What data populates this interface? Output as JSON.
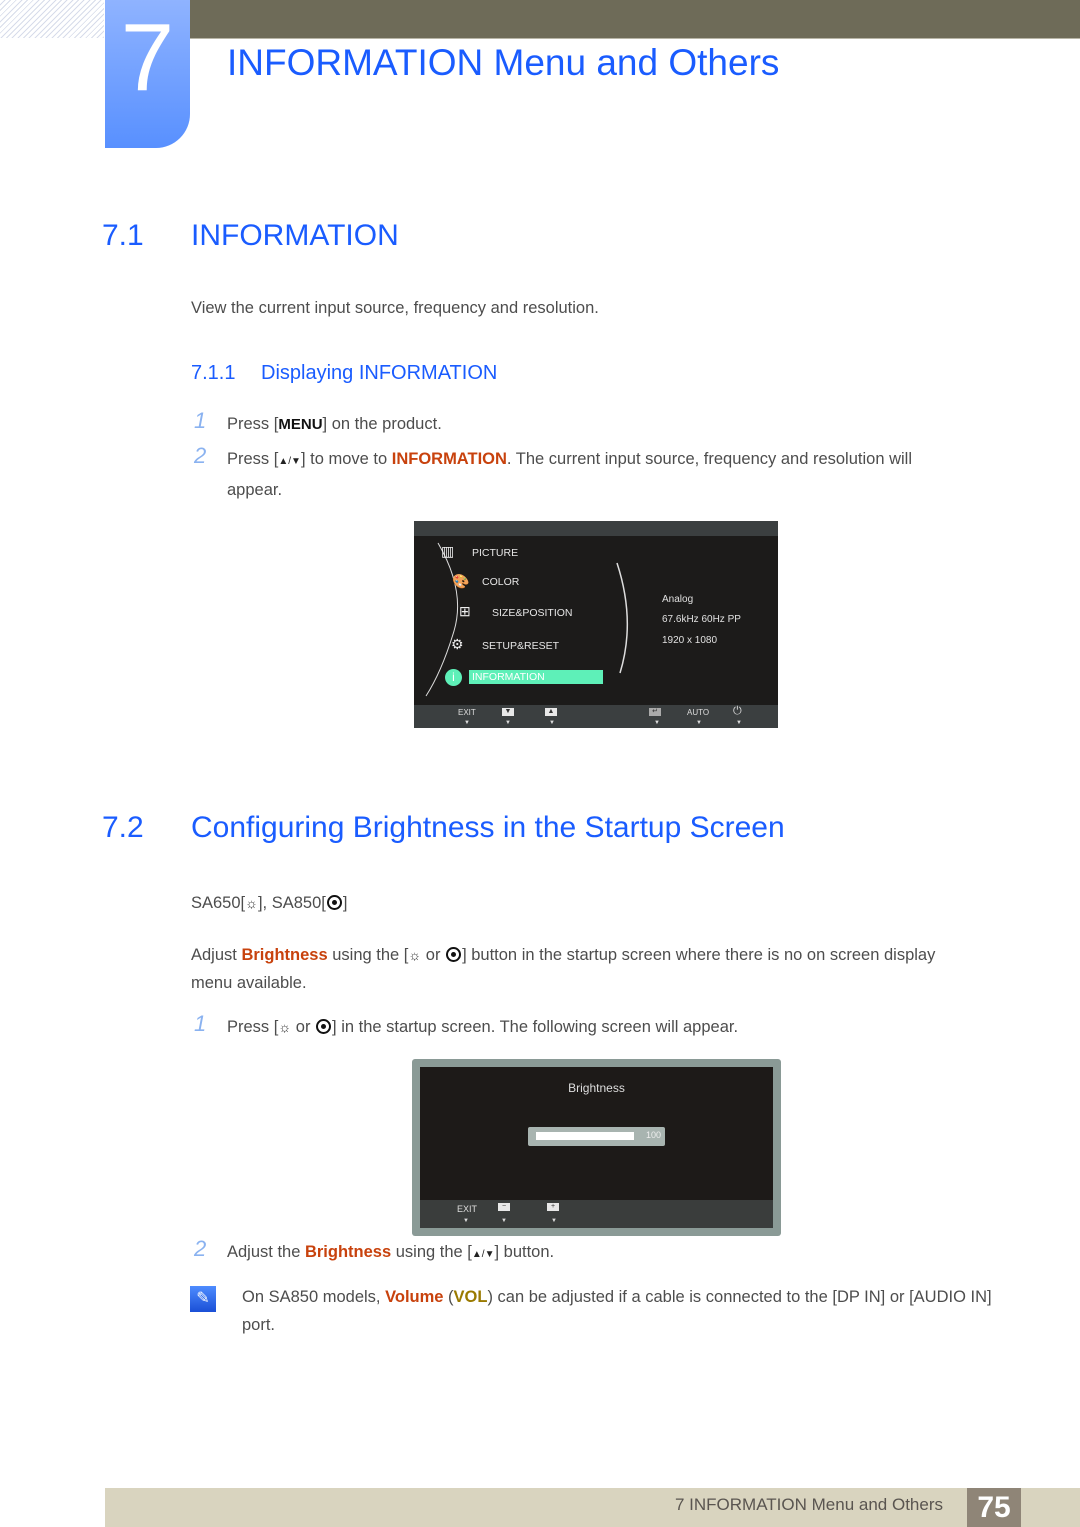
{
  "chapter": {
    "number": "7",
    "title": "INFORMATION Menu and Others"
  },
  "section1": {
    "number": "7.1",
    "title": "INFORMATION",
    "intro": "View the current input source, frequency and resolution.",
    "subsection": {
      "number": "7.1.1",
      "title": "Displaying INFORMATION"
    },
    "steps": [
      {
        "num": "1",
        "pre": "Press [",
        "key": "MENU",
        "post": "] on the product."
      },
      {
        "num": "2",
        "pre": "Press [",
        "arrows": "▲/▼",
        "mid": "] to move to ",
        "highlight": "INFORMATION",
        "post": ". The current input source, frequency and resolution will",
        "line2": "appear."
      }
    ]
  },
  "osd_menu": {
    "items": [
      "PICTURE",
      "COLOR",
      "SIZE&POSITION",
      "SETUP&RESET",
      "INFORMATION"
    ],
    "selected": "INFORMATION",
    "info": [
      "Analog",
      "67.6kHz 60Hz PP",
      "1920 x 1080"
    ],
    "buttons": [
      "EXIT",
      "▼",
      "▲",
      "↵",
      "AUTO",
      "⏻"
    ]
  },
  "section2": {
    "number": "7.2",
    "title": "Configuring Brightness in the Startup Screen",
    "models": {
      "a": "SA650[",
      "b": "], SA850[",
      "c": "]"
    },
    "para": {
      "pre": "Adjust ",
      "highlight": "Brightness",
      "mid": " using the [",
      "or": " or ",
      "post": "] button in the startup screen where there is no on screen display",
      "line2": "menu available."
    },
    "steps": [
      {
        "num": "1",
        "pre": "Press [",
        "or": " or ",
        "post": "] in the startup screen. The following screen will appear."
      },
      {
        "num": "2",
        "pre": "Adjust the ",
        "highlight": "Brightness",
        "mid": " using the [",
        "arrows": "▲/▼",
        "post": "] button."
      }
    ]
  },
  "osd_brightness": {
    "title": "Brightness",
    "value": "100",
    "percent": 100,
    "buttons": [
      "EXIT",
      "−",
      "+"
    ]
  },
  "note": {
    "pre": "On SA850 models, ",
    "hl1": "Volume",
    "p2": " (",
    "hl2": "VOL",
    "p3": ") can be adjusted if a cable is connected to the [DP IN] or [AUDIO IN]",
    "line2": "port."
  },
  "footer": {
    "text": "7 INFORMATION Menu and Others",
    "page": "75"
  }
}
